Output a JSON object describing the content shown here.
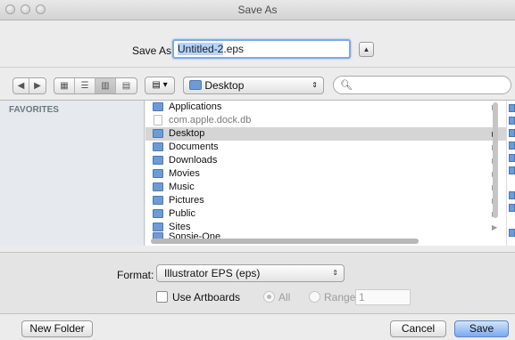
{
  "window": {
    "title": "Save As"
  },
  "save_as": {
    "label": "Save As:",
    "filename_base": "Untitled-2",
    "filename_ext": ".eps"
  },
  "toolbar": {
    "nav_icons": [
      "back-arrow-icon",
      "forward-arrow-icon"
    ],
    "view_icons": [
      "icon-view-icon",
      "list-view-icon",
      "column-view-icon",
      "coverflow-view-icon"
    ],
    "arrange_icon": "arrange-icon",
    "location": "Desktop",
    "search_placeholder": ""
  },
  "sidebar": {
    "heading": "FAVORITES"
  },
  "files": [
    {
      "name": "Applications",
      "type": "folder"
    },
    {
      "name": "com.apple.dock.db",
      "type": "file"
    },
    {
      "name": "Desktop",
      "type": "folder",
      "selected": true
    },
    {
      "name": "Documents",
      "type": "folder"
    },
    {
      "name": "Downloads",
      "type": "folder"
    },
    {
      "name": "Movies",
      "type": "folder"
    },
    {
      "name": "Music",
      "type": "folder"
    },
    {
      "name": "Pictures",
      "type": "folder"
    },
    {
      "name": "Public",
      "type": "folder"
    },
    {
      "name": "Sites",
      "type": "folder"
    },
    {
      "name": "Sonsie-One",
      "type": "folder"
    }
  ],
  "format": {
    "label": "Format:",
    "value": "Illustrator EPS (eps)",
    "use_artboards_label": "Use Artboards",
    "use_artboards_checked": false,
    "all_label": "All",
    "range_label": "Range:",
    "range_value": "1"
  },
  "buttons": {
    "new_folder": "New Folder",
    "cancel": "Cancel",
    "save": "Save"
  },
  "colors": {
    "accent": "#79aaf0",
    "selection": "#b5d3fb",
    "folder": "#6f9bd4"
  }
}
